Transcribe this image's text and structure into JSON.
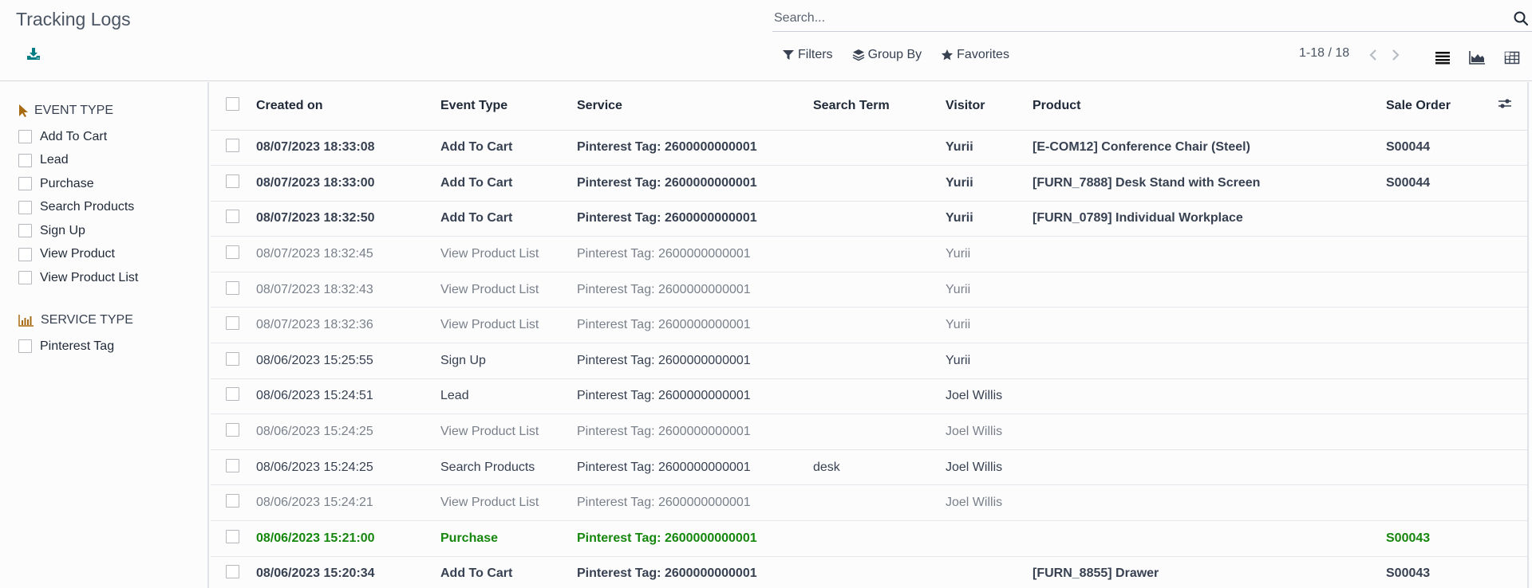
{
  "header": {
    "title": "Tracking Logs",
    "download_icon": "download-icon",
    "search_placeholder": "Search...",
    "search_value": "",
    "filters_label": "Filters",
    "group_by_label": "Group By",
    "favorites_label": "Favorites",
    "pager": "1-18 / 18",
    "views": [
      "list-view",
      "graph-view",
      "pivot-view"
    ]
  },
  "sidebar": {
    "event_type": {
      "title": "EVENT TYPE",
      "icon": "pointer-icon",
      "items": [
        "Add To Cart",
        "Lead",
        "Purchase",
        "Search Products",
        "Sign Up",
        "View Product",
        "View Product List"
      ]
    },
    "service_type": {
      "title": "SERVICE TYPE",
      "icon": "bar-chart-icon",
      "items": [
        "Pinterest Tag"
      ]
    }
  },
  "colors": {
    "accent_icon": "#a86a12",
    "download_icon": "#017e84",
    "success_text": "#16870d",
    "muted_text": "#7a808a"
  },
  "table": {
    "columns": [
      "Created on",
      "Event Type",
      "Service",
      "Search Term",
      "Visitor",
      "Product",
      "Sale Order"
    ],
    "rows": [
      {
        "style": "strong",
        "created_on": "08/07/2023 18:33:08",
        "event_type": "Add To Cart",
        "service": "Pinterest Tag: 2600000000001",
        "search_term": "",
        "visitor": "Yurii",
        "product": "[E-COM12] Conference Chair (Steel)",
        "sale_order": "S00044"
      },
      {
        "style": "strong",
        "created_on": "08/07/2023 18:33:00",
        "event_type": "Add To Cart",
        "service": "Pinterest Tag: 2600000000001",
        "search_term": "",
        "visitor": "Yurii",
        "product": "[FURN_7888] Desk Stand with Screen",
        "sale_order": "S00044"
      },
      {
        "style": "strong",
        "created_on": "08/07/2023 18:32:50",
        "event_type": "Add To Cart",
        "service": "Pinterest Tag: 2600000000001",
        "search_term": "",
        "visitor": "Yurii",
        "product": "[FURN_0789] Individual Workplace",
        "sale_order": ""
      },
      {
        "style": "muted",
        "created_on": "08/07/2023 18:32:45",
        "event_type": "View Product List",
        "service": "Pinterest Tag: 2600000000001",
        "search_term": "",
        "visitor": "Yurii",
        "product": "",
        "sale_order": ""
      },
      {
        "style": "muted",
        "created_on": "08/07/2023 18:32:43",
        "event_type": "View Product List",
        "service": "Pinterest Tag: 2600000000001",
        "search_term": "",
        "visitor": "Yurii",
        "product": "",
        "sale_order": ""
      },
      {
        "style": "muted",
        "created_on": "08/07/2023 18:32:36",
        "event_type": "View Product List",
        "service": "Pinterest Tag: 2600000000001",
        "search_term": "",
        "visitor": "Yurii",
        "product": "",
        "sale_order": ""
      },
      {
        "style": "normal",
        "created_on": "08/06/2023 15:25:55",
        "event_type": "Sign Up",
        "service": "Pinterest Tag: 2600000000001",
        "search_term": "",
        "visitor": "Yurii",
        "product": "",
        "sale_order": ""
      },
      {
        "style": "normal",
        "created_on": "08/06/2023 15:24:51",
        "event_type": "Lead",
        "service": "Pinterest Tag: 2600000000001",
        "search_term": "",
        "visitor": "Joel Willis",
        "product": "",
        "sale_order": ""
      },
      {
        "style": "muted",
        "created_on": "08/06/2023 15:24:25",
        "event_type": "View Product List",
        "service": "Pinterest Tag: 2600000000001",
        "search_term": "",
        "visitor": "Joel Willis",
        "product": "",
        "sale_order": ""
      },
      {
        "style": "normal",
        "created_on": "08/06/2023 15:24:25",
        "event_type": "Search Products",
        "service": "Pinterest Tag: 2600000000001",
        "search_term": "desk",
        "visitor": "Joel Willis",
        "product": "",
        "sale_order": ""
      },
      {
        "style": "muted",
        "created_on": "08/06/2023 15:24:21",
        "event_type": "View Product List",
        "service": "Pinterest Tag: 2600000000001",
        "search_term": "",
        "visitor": "Joel Willis",
        "product": "",
        "sale_order": ""
      },
      {
        "style": "success",
        "created_on": "08/06/2023 15:21:00",
        "event_type": "Purchase",
        "service": "Pinterest Tag: 2600000000001",
        "search_term": "",
        "visitor": "",
        "product": "",
        "sale_order": "S00043"
      },
      {
        "style": "strong",
        "created_on": "08/06/2023 15:20:34",
        "event_type": "Add To Cart",
        "service": "Pinterest Tag: 2600000000001",
        "search_term": "",
        "visitor": "",
        "product": "[FURN_8855] Drawer",
        "sale_order": "S00043"
      }
    ]
  }
}
